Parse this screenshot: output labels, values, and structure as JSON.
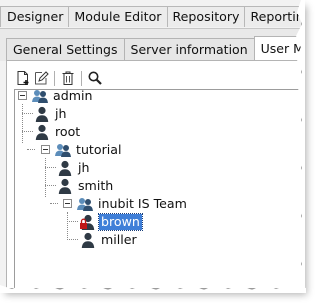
{
  "top_tabs": [
    "Designer",
    "Module Editor",
    "Repository",
    "Reporting"
  ],
  "sub_tabs": [
    {
      "label": "General Settings"
    },
    {
      "label": "Server information"
    },
    {
      "label": "User Mana",
      "active": true
    }
  ],
  "toolbar": {
    "buttons": [
      "new-document-icon",
      "edit-icon",
      "delete-icon",
      "search-icon"
    ]
  },
  "tree": {
    "root": {
      "label": "admin",
      "icon": "group-icon"
    },
    "admin_children": [
      {
        "label": "jh"
      },
      {
        "label": "root"
      }
    ],
    "tutorial": {
      "label": "tutorial",
      "icon": "group-icon"
    },
    "tutorial_children": [
      {
        "label": "jh"
      },
      {
        "label": "smith"
      }
    ],
    "team": {
      "label": "inubit IS Team",
      "icon": "group-icon"
    },
    "team_children": [
      {
        "label": "brown",
        "selected": true,
        "locked": true
      },
      {
        "label": "miller"
      }
    ]
  },
  "colors": {
    "selection": "#3f7fd8",
    "user_icon": "#2f3a45",
    "group_icon": "#4a7aa8",
    "lock": "#c01818"
  }
}
